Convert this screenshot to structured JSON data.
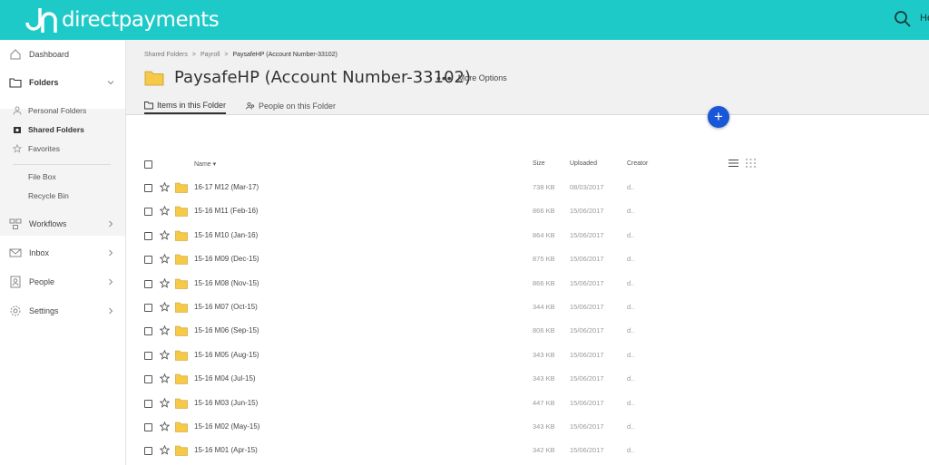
{
  "app": {
    "brand": "directpayments",
    "user_stub": "He"
  },
  "sidebar": {
    "items": [
      {
        "label": "Dashboard"
      },
      {
        "label": "Folders"
      },
      {
        "label": "Workflows"
      },
      {
        "label": "Inbox"
      },
      {
        "label": "People"
      },
      {
        "label": "Settings"
      }
    ],
    "sub_items": [
      {
        "label": "Personal Folders"
      },
      {
        "label": "Shared Folders"
      },
      {
        "label": "Favorites"
      },
      {
        "label": "File Box"
      },
      {
        "label": "Recycle Bin"
      }
    ]
  },
  "breadcrumb": [
    "Shared Folders",
    "Payroll",
    "PaysafeHP (Account Number-33102)"
  ],
  "breadcrumb_sep": ">",
  "page": {
    "title": "PaysafeHP (Account Number-33102)",
    "more_options": "More Options"
  },
  "tabs": [
    {
      "label": "Items in this Folder"
    },
    {
      "label": "People on this Folder"
    }
  ],
  "fab_label": "+",
  "table": {
    "columns": {
      "name": "Name",
      "size": "Size",
      "uploaded": "Uploaded",
      "creator": "Creator"
    },
    "rows": [
      {
        "name": "16-17 M12 (Mar-17)",
        "size": "738 KB",
        "uploaded": "08/03/2017",
        "creator": "d.."
      },
      {
        "name": "15-16 M11 (Feb-16)",
        "size": "866 KB",
        "uploaded": "15/06/2017",
        "creator": "d.."
      },
      {
        "name": "15-16 M10 (Jan-16)",
        "size": "864 KB",
        "uploaded": "15/06/2017",
        "creator": "d.."
      },
      {
        "name": "15-16 M09 (Dec-15)",
        "size": "875 KB",
        "uploaded": "15/06/2017",
        "creator": "d.."
      },
      {
        "name": "15-16 M08 (Nov-15)",
        "size": "866 KB",
        "uploaded": "15/06/2017",
        "creator": "d.."
      },
      {
        "name": "15-16 M07 (Oct-15)",
        "size": "344 KB",
        "uploaded": "15/06/2017",
        "creator": "d.."
      },
      {
        "name": "15-16 M06 (Sep-15)",
        "size": "806 KB",
        "uploaded": "15/06/2017",
        "creator": "d.."
      },
      {
        "name": "15-16 M05 (Aug-15)",
        "size": "343 KB",
        "uploaded": "15/06/2017",
        "creator": "d.."
      },
      {
        "name": "15-16 M04 (Jul-15)",
        "size": "343 KB",
        "uploaded": "15/06/2017",
        "creator": "d.."
      },
      {
        "name": "15-16 M03 (Jun-15)",
        "size": "447 KB",
        "uploaded": "15/06/2017",
        "creator": "d.."
      },
      {
        "name": "15-16 M02 (May-15)",
        "size": "343 KB",
        "uploaded": "15/06/2017",
        "creator": "d.."
      },
      {
        "name": "15-16 M01 (Apr-15)",
        "size": "342 KB",
        "uploaded": "15/06/2017",
        "creator": "d.."
      }
    ]
  },
  "colors": {
    "brand": "#1ecac7",
    "accent": "#1857d8",
    "folder": "#f7c948"
  },
  "icons": [
    "search-icon",
    "home-icon",
    "folder-icon",
    "person-icon",
    "shared-folder-icon",
    "star-icon",
    "workflow-icon",
    "mail-icon",
    "people-icon",
    "gear-icon",
    "chevron-right-icon",
    "chevron-down-icon",
    "list-view-icon",
    "grid-view-icon",
    "plus-icon"
  ]
}
